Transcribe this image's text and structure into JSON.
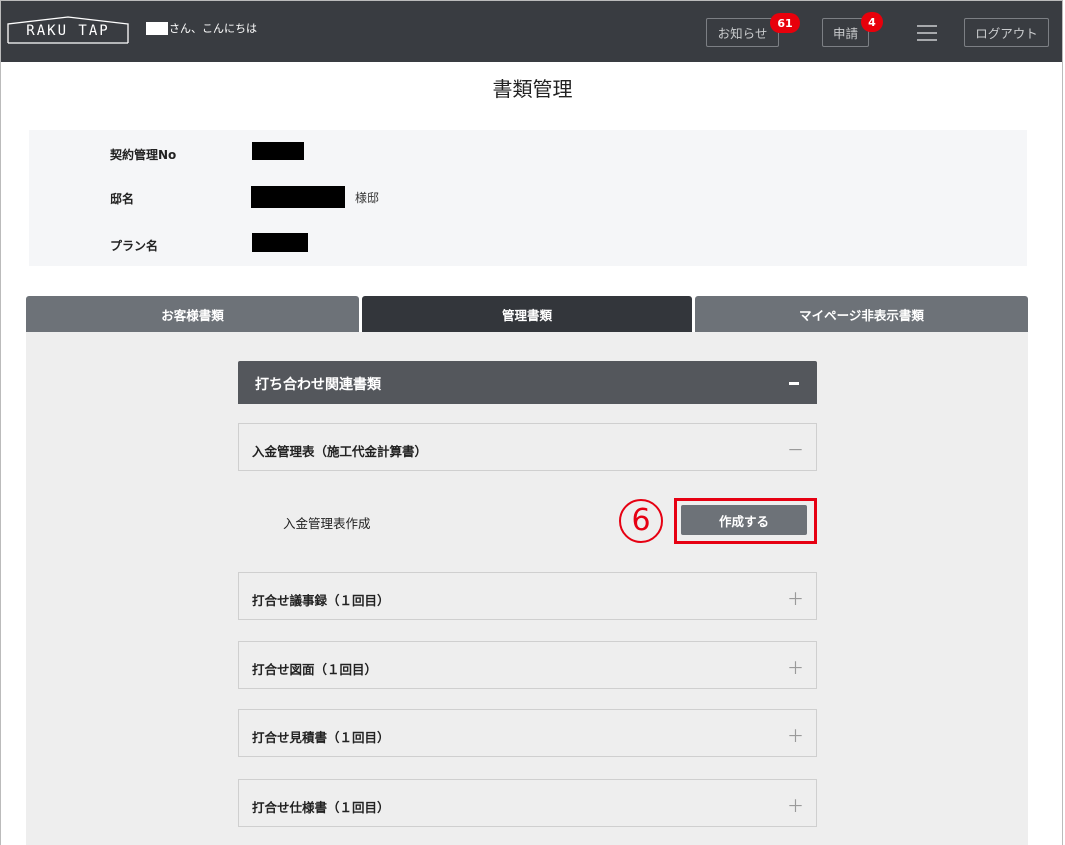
{
  "header": {
    "logo_text": "RAKU TAP",
    "greeting": "さん、こんにちは",
    "notice_label": "お知らせ",
    "notice_count": "61",
    "request_label": "申請",
    "request_count": "4",
    "logout_label": "ログアウト",
    "bg_color": "#393c41",
    "badge_color": "#e8000b"
  },
  "page_title": "書類管理",
  "info": {
    "contract_label": "契約管理No",
    "name_label": "邸名",
    "name_suffix": "様邸",
    "plan_label": "プラン名"
  },
  "tabs": [
    {
      "label": "お客様書類",
      "active": false
    },
    {
      "label": "管理書類",
      "active": true
    },
    {
      "label": "マイページ非表示書類",
      "active": false
    }
  ],
  "section": {
    "title": "打ち合わせ関連書類",
    "items": [
      {
        "label": "入金管理表（施工代金計算書）",
        "symbol": "－",
        "expanded": true
      },
      {
        "label": "打合せ議事録（１回目）",
        "symbol": "＋"
      },
      {
        "label": "打合せ図面（１回目）",
        "symbol": "＋"
      },
      {
        "label": "打合せ見積書（１回目）",
        "symbol": "＋"
      },
      {
        "label": "打合せ仕様書（１回目）",
        "symbol": "＋"
      }
    ],
    "sub_item_label": "入金管理表作成",
    "create_button": "作成する"
  },
  "annotation": {
    "step_number": "6",
    "color": "#e60012"
  }
}
